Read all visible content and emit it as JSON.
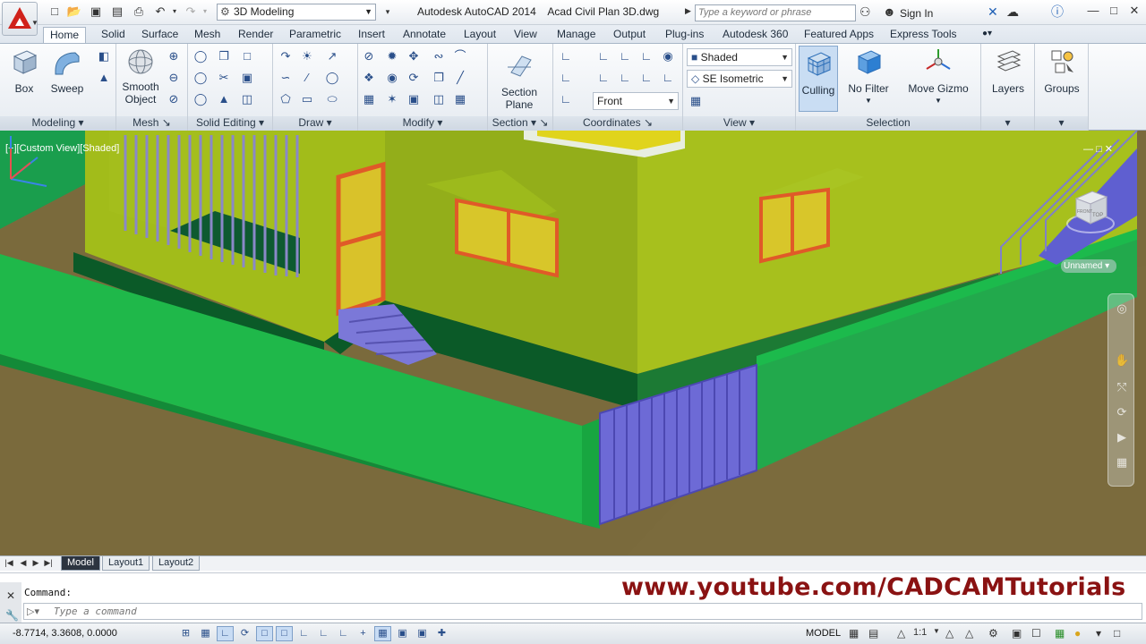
{
  "titlebar": {
    "workspace": "3D Modeling",
    "title": "Autodesk AutoCAD 2014    Acad Civil Plan 3D.dwg",
    "search_placeholder": "Type a keyword or phrase",
    "sign_in": "Sign In"
  },
  "tabs": [
    "Home",
    "Solid",
    "Surface",
    "Mesh",
    "Render",
    "Parametric",
    "Insert",
    "Annotate",
    "Layout",
    "View",
    "Manage",
    "Output",
    "Plug-ins",
    "Autodesk 360",
    "Featured Apps",
    "Express Tools"
  ],
  "ribbon": {
    "modeling": {
      "box": "Box",
      "sweep": "Sweep",
      "label": "Modeling"
    },
    "mesh": {
      "smooth": "Smooth",
      "object": "Object",
      "label": "Mesh"
    },
    "solid_editing": {
      "label": "Solid Editing"
    },
    "draw": {
      "label": "Draw"
    },
    "modify": {
      "label": "Modify"
    },
    "section": {
      "plane1": "Section",
      "plane2": "Plane",
      "label": "Section"
    },
    "coordinates": {
      "label": "Coordinates"
    },
    "view": {
      "visual_style": "Shaded",
      "view_dir": "SE Isometric",
      "view_front": "Front",
      "label": "View"
    },
    "selection": {
      "culling": "Culling",
      "no_filter": "No Filter",
      "move_gizmo": "Move Gizmo",
      "label": "Selection"
    },
    "layers": {
      "label": "Layers"
    },
    "groups": {
      "label": "Groups"
    }
  },
  "viewport": {
    "label": "[−][Custom View][Shaded]",
    "viewcube_top": "TOP",
    "viewcube_front": "FRONT",
    "unnamed": "Unnamed"
  },
  "layout_tabs": [
    "Model",
    "Layout1",
    "Layout2"
  ],
  "command": {
    "history": "Command:",
    "placeholder": "Type a command",
    "watermark": "www.youtube.com/CADCAMTutorials"
  },
  "status": {
    "coords": "-8.7714, 3.3608, 0.0000",
    "model": "MODEL",
    "scale": "1:1"
  }
}
